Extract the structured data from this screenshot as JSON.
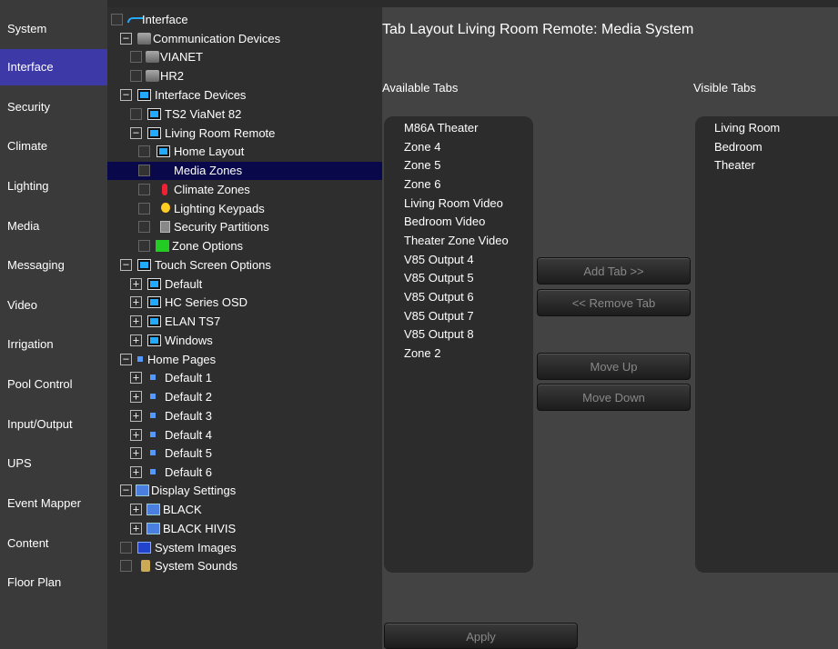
{
  "nav": {
    "items": [
      "System",
      "Interface",
      "Security",
      "Climate",
      "Lighting",
      "Media",
      "Messaging",
      "Video",
      "Irrigation",
      "Pool Control",
      "Input/Output",
      "UPS",
      "Event Mapper",
      "Content",
      "Floor Plan"
    ],
    "active": "Interface"
  },
  "tree": {
    "items": [
      {
        "label": "Interface"
      },
      {
        "label": "Communication Devices"
      },
      {
        "label": "VIANET"
      },
      {
        "label": "HR2"
      },
      {
        "label": "Interface Devices"
      },
      {
        "label": "TS2 ViaNet 82"
      },
      {
        "label": "Living Room Remote"
      },
      {
        "label": "Home Layout"
      },
      {
        "label": "Media Zones"
      },
      {
        "label": "Climate Zones"
      },
      {
        "label": "Lighting Keypads"
      },
      {
        "label": "Security Partitions"
      },
      {
        "label": "Zone Options"
      },
      {
        "label": "Touch Screen Options"
      },
      {
        "label": "Default"
      },
      {
        "label": "HC Series OSD"
      },
      {
        "label": "ELAN TS7"
      },
      {
        "label": "Windows"
      },
      {
        "label": "Home Pages"
      },
      {
        "label": "Default 1"
      },
      {
        "label": "Default 2"
      },
      {
        "label": "Default 3"
      },
      {
        "label": "Default 4"
      },
      {
        "label": "Default 5"
      },
      {
        "label": "Default 6"
      },
      {
        "label": "Display Settings"
      },
      {
        "label": "BLACK"
      },
      {
        "label": "BLACK HIVIS"
      },
      {
        "label": "System Images"
      },
      {
        "label": "System Sounds"
      }
    ],
    "selected": "Media Zones"
  },
  "main": {
    "title": "Tab Layout Living Room Remote: Media System",
    "available_label": "Available Tabs",
    "visible_label": "Visible Tabs",
    "available_tabs": [
      "M86A Theater",
      "Zone 4",
      "Zone 5",
      "Zone 6",
      "Living Room Video",
      "Bedroom Video",
      "Theater Zone Video",
      "V85 Output 4",
      "V85 Output 5",
      "V85 Output 6",
      "V85 Output 7",
      "V85 Output 8",
      "Zone 2"
    ],
    "visible_tabs": [
      "Living Room",
      "Bedroom",
      "Theater"
    ],
    "buttons": {
      "add": "Add Tab >>",
      "remove": "<< Remove Tab",
      "move_up": "Move Up",
      "move_down": "Move Down",
      "apply": "Apply"
    }
  },
  "colors": {
    "accent": "#3d3aa8",
    "selection": "#08084a",
    "panel": "#434343",
    "listbox": "#2c2c2c"
  }
}
